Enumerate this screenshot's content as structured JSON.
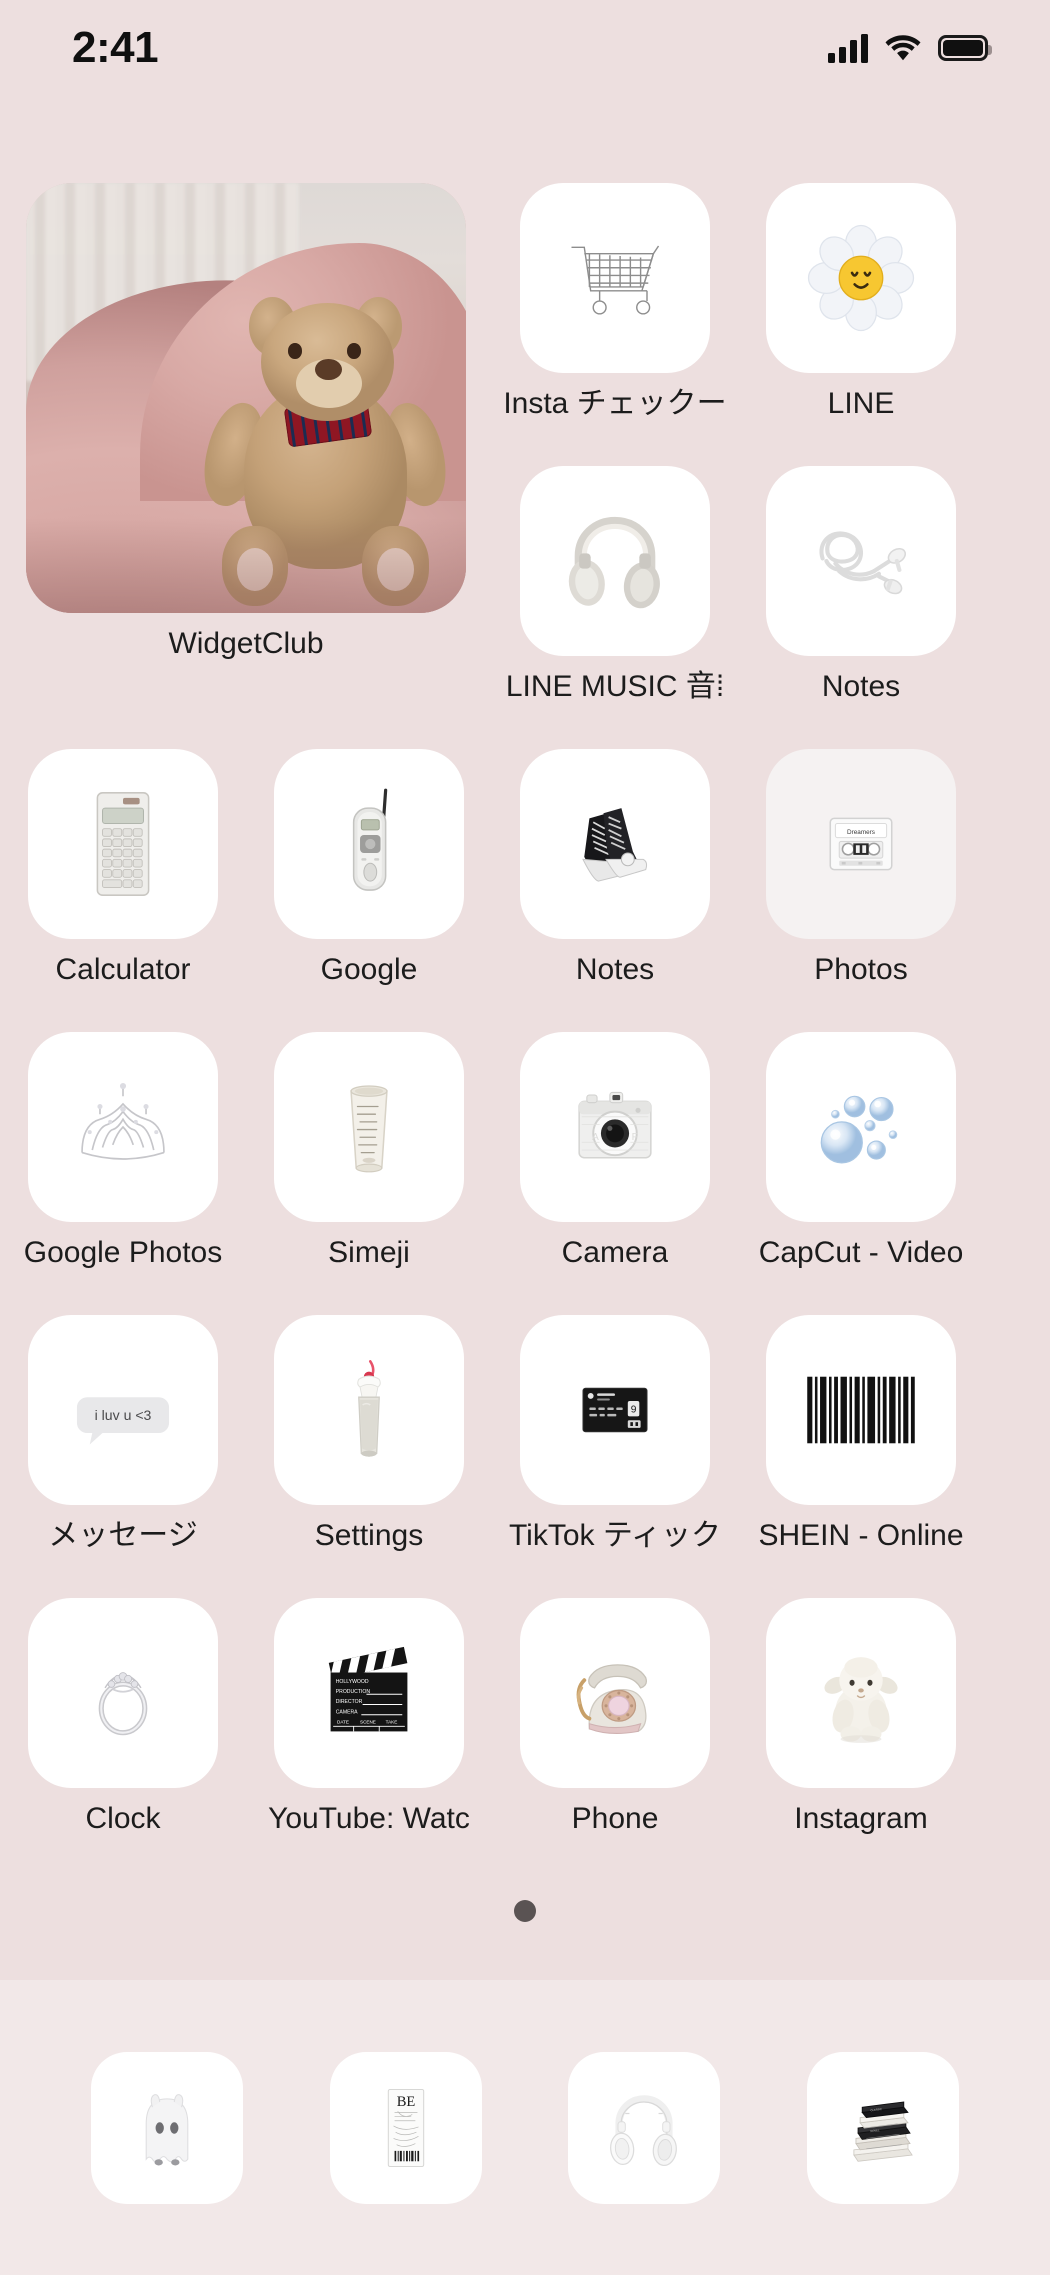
{
  "status_bar": {
    "time": "2:41",
    "signal_icon": "cellular-signal-icon",
    "wifi_icon": "wifi-icon",
    "battery_icon": "battery-icon"
  },
  "wallpaper_color": "#eddfdf",
  "tile_color": "#ffffff",
  "widget": {
    "label": "WidgetClub",
    "image_description": "teddy bear with plaid bow sitting on a pink chair with white curtains"
  },
  "grid": {
    "rows": [
      {
        "apps": [
          {
            "label": "Insta チェックー",
            "icon": "shopping-cart-icon",
            "tile": "white"
          },
          {
            "label": "LINE",
            "icon": "daisy-flower-icon",
            "tile": "white"
          }
        ]
      },
      {
        "apps": [
          {
            "label": "LINE MUSIC 音⁞",
            "icon": "over-ear-headphones-icon",
            "tile": "white"
          },
          {
            "label": "Notes",
            "icon": "earbuds-icon",
            "tile": "white"
          }
        ]
      },
      {
        "apps": [
          {
            "label": "Calculator",
            "icon": "calculator-icon",
            "tile": "white"
          },
          {
            "label": "Google",
            "icon": "flip-phone-icon",
            "tile": "white"
          },
          {
            "label": "Notes",
            "icon": "sneakers-icon",
            "tile": "white"
          },
          {
            "label": "Photos",
            "icon": "cassette-tape-icon",
            "tile": "tint"
          }
        ]
      },
      {
        "apps": [
          {
            "label": "Google Photos",
            "icon": "tiara-crown-icon",
            "tile": "white"
          },
          {
            "label": "Simeji",
            "icon": "paper-cup-icon",
            "tile": "white"
          },
          {
            "label": "Camera",
            "icon": "compact-camera-icon",
            "tile": "white"
          },
          {
            "label": "CapCut - Video",
            "icon": "bubbles-icon",
            "tile": "white"
          }
        ]
      },
      {
        "apps": [
          {
            "label": "メッセージ",
            "icon": "message-bubble-icon",
            "bubble_text": "i luv u <3",
            "tile": "white"
          },
          {
            "label": "Settings",
            "icon": "milkshake-icon",
            "tile": "white"
          },
          {
            "label": "TikTok ティック",
            "icon": "black-card-icon",
            "tile": "white"
          },
          {
            "label": "SHEIN - Online",
            "icon": "barcode-icon",
            "tile": "white"
          }
        ]
      },
      {
        "apps": [
          {
            "label": "Clock",
            "icon": "ring-icon",
            "tile": "white"
          },
          {
            "label": "YouTube: Watc",
            "icon": "clapperboard-icon",
            "tile": "white"
          },
          {
            "label": "Phone",
            "icon": "rotary-phone-icon",
            "tile": "white"
          },
          {
            "label": "Instagram",
            "icon": "lamb-plush-icon",
            "tile": "white"
          }
        ]
      }
    ]
  },
  "page_indicator": {
    "total": 1,
    "current": 1
  },
  "dock": {
    "apps": [
      {
        "icon": "ghost-figure-icon"
      },
      {
        "icon": "be-poster-ticket-icon"
      },
      {
        "icon": "white-headphones-icon"
      },
      {
        "icon": "book-stack-icon"
      }
    ]
  },
  "clapperboard_text": {
    "line1": "HOLLYWOOD",
    "line2": "PRODUCTION",
    "line3": "DIRECTOR",
    "line4": "CAMERA",
    "l1": "DATE",
    "l2": "SCENE",
    "l3": "TAKE"
  },
  "cassette_text": "Dreamers",
  "poster_text": "BE"
}
